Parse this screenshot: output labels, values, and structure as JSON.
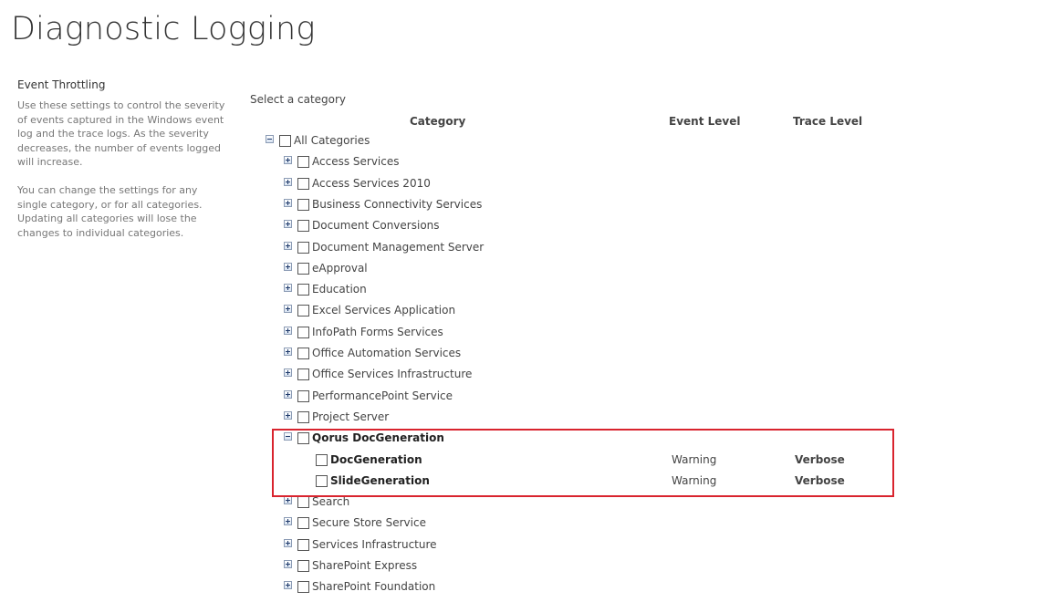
{
  "page": {
    "title": "Diagnostic Logging"
  },
  "side": {
    "heading": "Event Throttling",
    "paragraphs": [
      "Use these settings to control the severity of events captured in the Windows event log and the trace logs. As the severity decreases, the number of events logged will increase.",
      "You can change the settings for any single category, or for all categories. Updating all categories will lose the changes to individual categories."
    ]
  },
  "main": {
    "select_label": "Select a category",
    "columns": {
      "category": "Category",
      "event_level": "Event Level",
      "trace_level": "Trace Level"
    },
    "root": {
      "label": "All Categories",
      "expanded": true,
      "checked": false
    },
    "categories_before": [
      "Access Services",
      "Access Services 2010",
      "Business Connectivity Services",
      "Document Conversions",
      "Document Management Server",
      "eApproval",
      "Education",
      "Excel Services Application",
      "InfoPath Forms Services",
      "Office Automation Services",
      "Office Services Infrastructure",
      "PerformancePoint Service",
      "Project Server"
    ],
    "expanded_category": {
      "label": "Qorus DocGeneration",
      "children": [
        {
          "label": "DocGeneration",
          "event_level": "Warning",
          "trace_level": "Verbose"
        },
        {
          "label": "SlideGeneration",
          "event_level": "Warning",
          "trace_level": "Verbose"
        }
      ]
    },
    "categories_after": [
      "Search",
      "Secure Store Service",
      "Services Infrastructure",
      "SharePoint Express",
      "SharePoint Foundation"
    ]
  },
  "colors": {
    "highlight_border": "#d9242e",
    "text": "#444444",
    "muted_text": "#777777"
  },
  "icons": {
    "collapse": "minus-box-icon",
    "expand": "plus-box-icon",
    "checkbox": "checkbox"
  }
}
